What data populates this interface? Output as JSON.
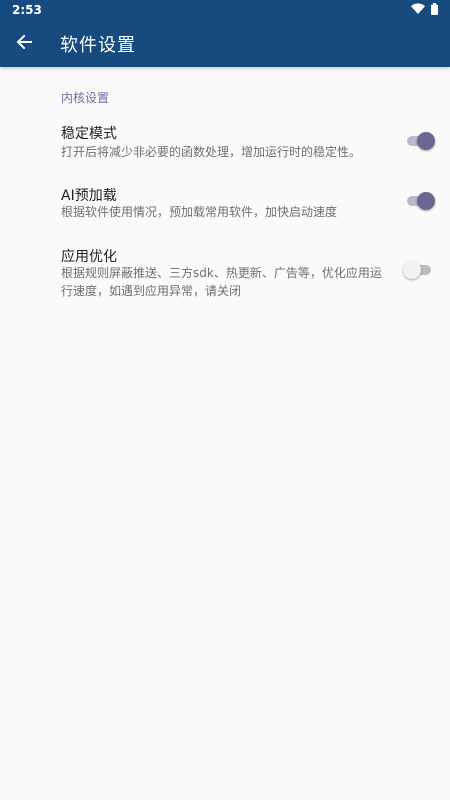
{
  "status_bar": {
    "time": "2:53"
  },
  "app_bar": {
    "title": "软件设置"
  },
  "section": {
    "header": "内核设置"
  },
  "preferences": [
    {
      "title": "稳定模式",
      "summary": "打开后将减少非必要的函数处理，增加运行时的稳定性。",
      "enabled": true
    },
    {
      "title": "AI预加载",
      "summary": "根据软件使用情况，预加载常用软件，加快启动速度",
      "enabled": true
    },
    {
      "title": "应用优化",
      "summary": "根据规则屏蔽推送、三方sdk、热更新、广告等，优化应用运行速度，如遇到应用异常，请关闭",
      "enabled": false
    }
  ],
  "colors": {
    "primary": "#174a7e",
    "accent_on": "#6a6891",
    "section_header": "#6b6fa0",
    "background": "#fafafa"
  },
  "icons": {
    "back": "arrow-left-icon",
    "wifi": "wifi-icon",
    "battery": "battery-icon"
  }
}
